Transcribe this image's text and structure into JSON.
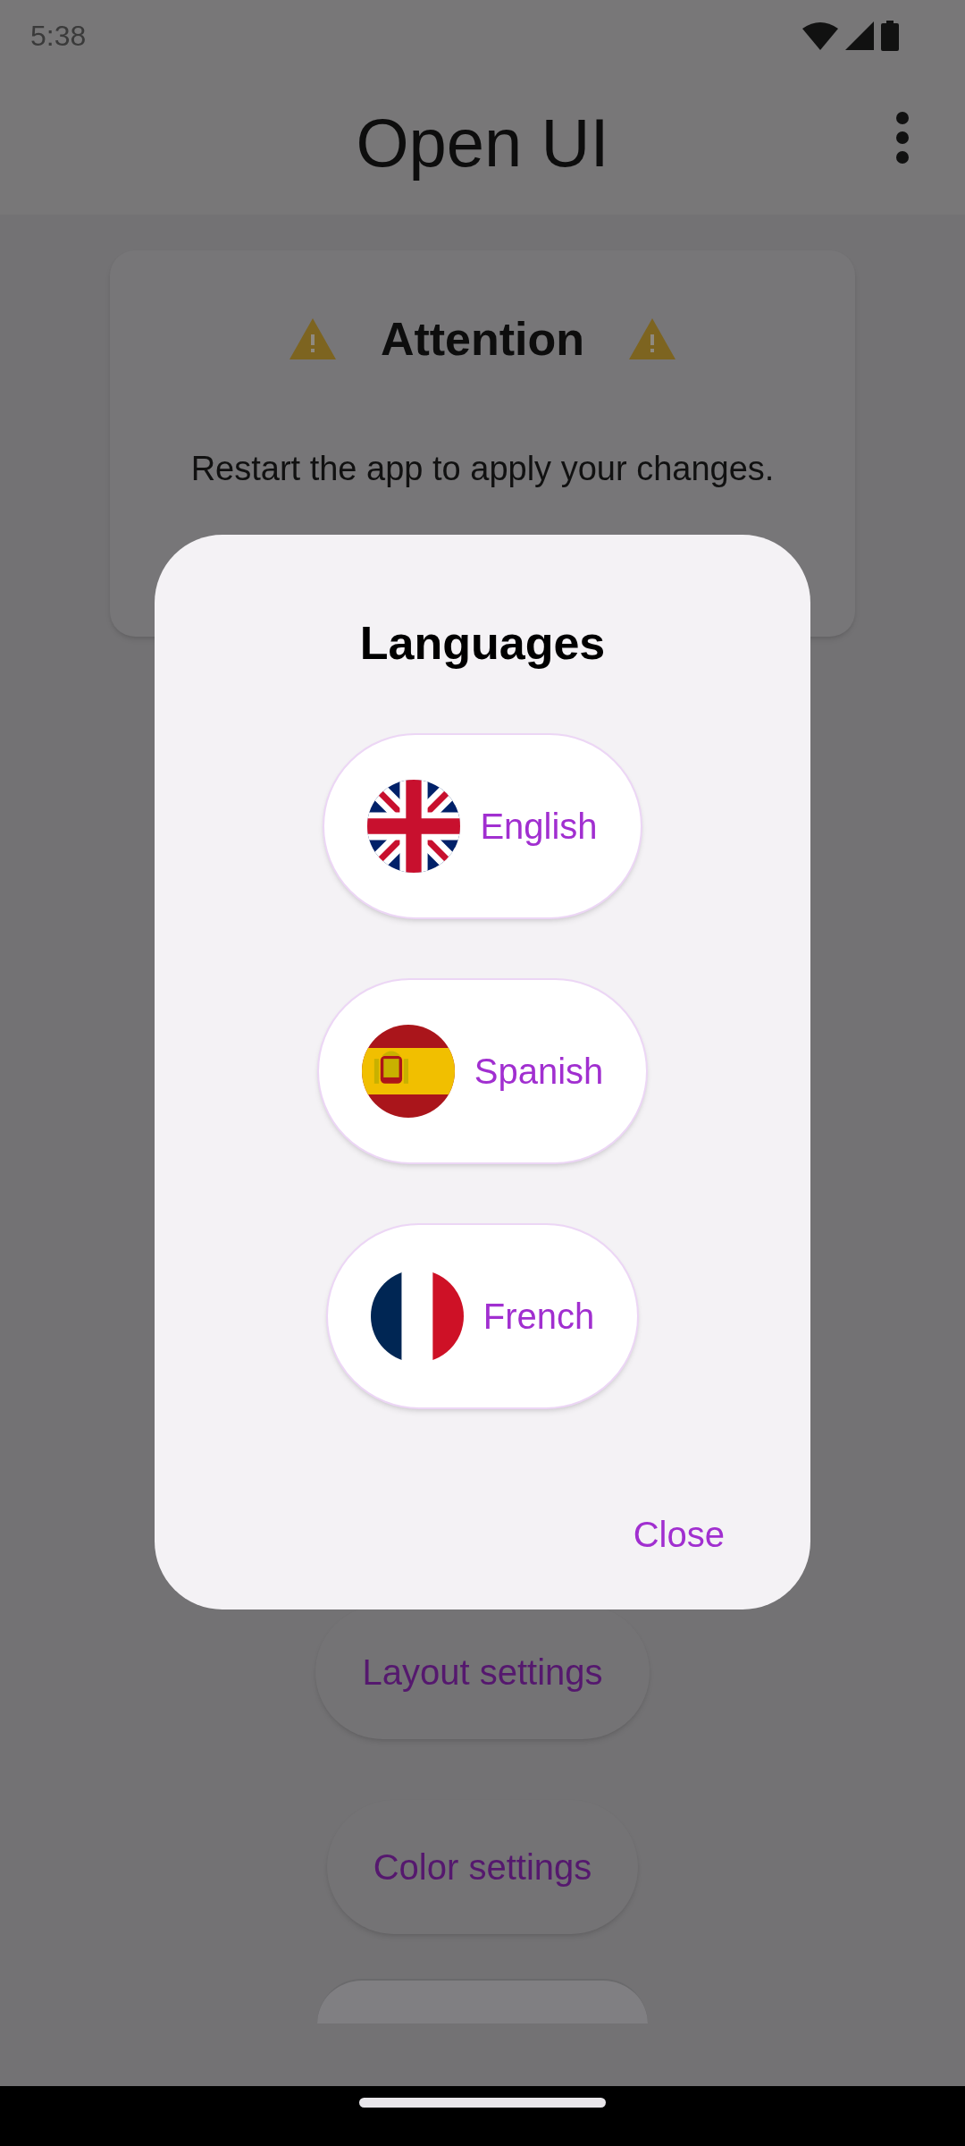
{
  "status_bar": {
    "time": "5:38"
  },
  "app_bar": {
    "title": "Open UI"
  },
  "attention_card": {
    "title": "Attention",
    "message": "Restart the app to apply your changes."
  },
  "settings_buttons": [
    "Layout settings",
    "Color settings"
  ],
  "dialog": {
    "title": "Languages",
    "languages": [
      {
        "label": "English",
        "kind": "uk"
      },
      {
        "label": "Spanish",
        "kind": "es"
      },
      {
        "label": "French",
        "kind": "fr"
      }
    ],
    "close_button": "Close"
  }
}
